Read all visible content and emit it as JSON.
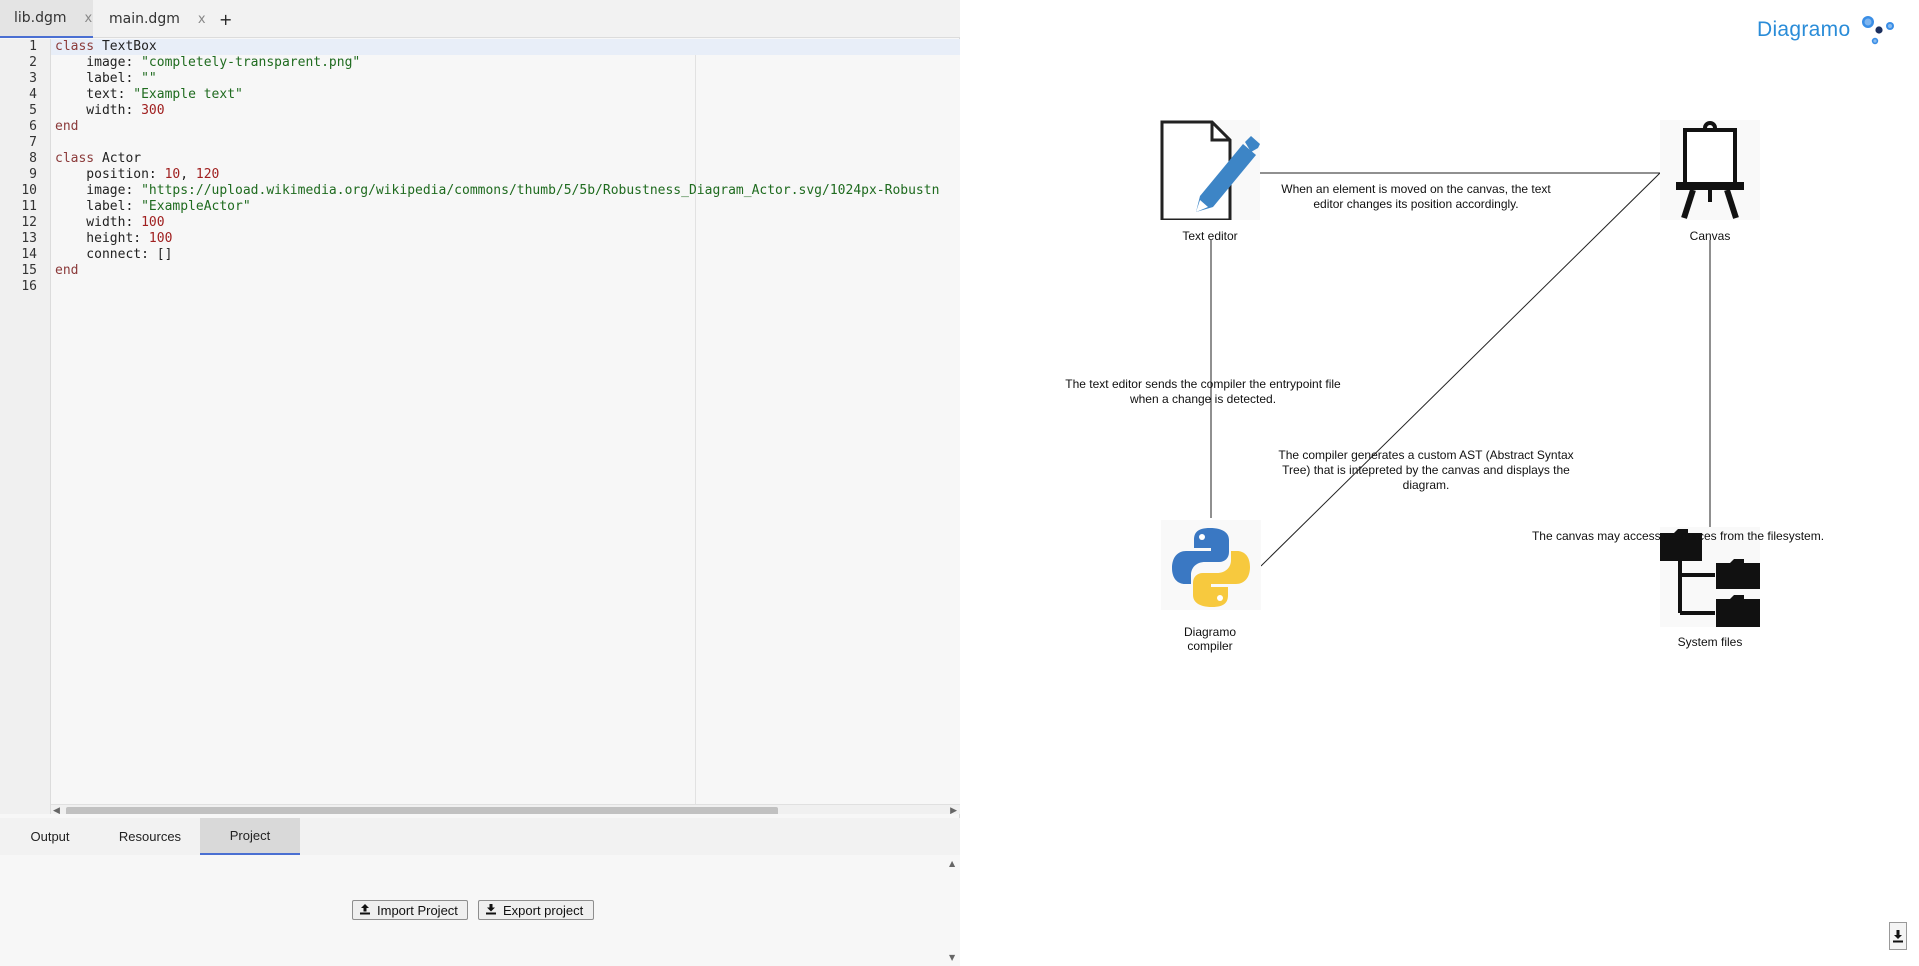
{
  "tabs": [
    {
      "label": "lib.dgm",
      "close": "x"
    },
    {
      "label": "main.dgm",
      "close": "x"
    }
  ],
  "add_tab": "+",
  "editor": {
    "line_numbers": [
      "1",
      "2",
      "3",
      "4",
      "5",
      "6",
      "7",
      "8",
      "9",
      "10",
      "11",
      "12",
      "13",
      "14",
      "15",
      "16"
    ],
    "lines": {
      "l1_kw": "class",
      "l1_name": " TextBox",
      "l2_key": "    image: ",
      "l2_val": "\"completely-transparent.png\"",
      "l3_key": "    label: ",
      "l3_val": "\"\"",
      "l4_key": "    text: ",
      "l4_val": "\"Example text\"",
      "l5_key": "    width: ",
      "l5_val": "300",
      "l6_kw": "end",
      "l8_kw": "class",
      "l8_name": " Actor",
      "l9_key": "    position: ",
      "l9_v1": "10",
      "l9_sep": ", ",
      "l9_v2": "120",
      "l10_key": "    image: ",
      "l10_val": "\"https://upload.wikimedia.org/wikipedia/commons/thumb/5/5b/Robustness_Diagram_Actor.svg/1024px-Robustn",
      "l11_key": "    label: ",
      "l11_val": "\"ExampleActor\"",
      "l12_key": "    width: ",
      "l12_val": "100",
      "l13_key": "    height: ",
      "l13_val": "100",
      "l14_key": "    connect: ",
      "l14_val": "[]",
      "l15_kw": "end"
    }
  },
  "bottom_tabs": {
    "output": "Output",
    "resources": "Resources",
    "project": "Project"
  },
  "project": {
    "import_label": "Import Project",
    "export_label": "Export project"
  },
  "canvas": {
    "logo": "Diagramo",
    "nodes": {
      "text_editor": "Text editor",
      "canvas": "Canvas",
      "compiler_line1": "Diagramo",
      "compiler_line2": "compiler",
      "system_files": "System files"
    },
    "edges": {
      "editor_canvas_1": "When an element is moved on the canvas, the text",
      "editor_canvas_2": "editor changes its position accordingly.",
      "editor_compiler_1": "The text editor sends the compiler the entrypoint file",
      "editor_compiler_2": "when a change is detected.",
      "compiler_canvas_1": "The compiler generates a custom AST (Abstract Syntax",
      "compiler_canvas_2": "Tree) that is intepreted by the canvas and displays the",
      "compiler_canvas_3": "diagram.",
      "canvas_files": "The canvas may access resources from the filesystem."
    },
    "colors": {
      "logo": "#2a8cd8",
      "python_blue": "#3a78c3",
      "python_yellow": "#f7c93e",
      "pencil": "#3d85c6"
    }
  }
}
